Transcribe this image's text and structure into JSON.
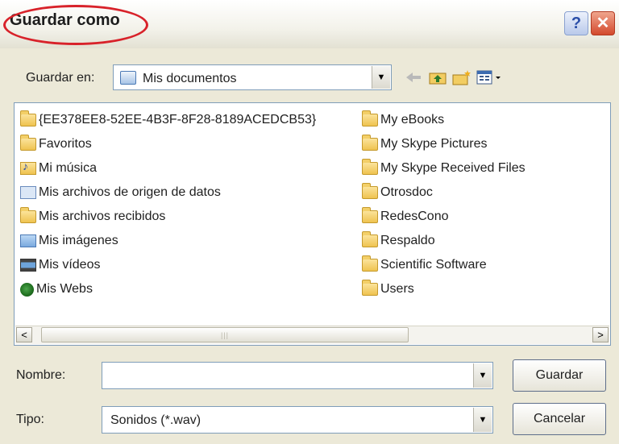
{
  "window": {
    "title": "Guardar como"
  },
  "toolbar": {
    "save_in_label": "Guardar en:",
    "location": "Mis documentos"
  },
  "files": {
    "left_column": [
      {
        "name": "{EE378EE8-52EE-4B3F-8F28-8189ACEDCB53}",
        "icon": "folder-icon"
      },
      {
        "name": "Favoritos",
        "icon": "folder-icon"
      },
      {
        "name": "Mi música",
        "icon": "music-folder-icon"
      },
      {
        "name": "Mis archivos de origen de datos",
        "icon": "data-sources-icon"
      },
      {
        "name": "Mis archivos recibidos",
        "icon": "folder-icon"
      },
      {
        "name": "Mis imágenes",
        "icon": "pictures-folder-icon"
      },
      {
        "name": "Mis vídeos",
        "icon": "videos-folder-icon"
      },
      {
        "name": "Mis Webs",
        "icon": "webs-globe-icon"
      }
    ],
    "right_column": [
      {
        "name": "My eBooks",
        "icon": "folder-icon"
      },
      {
        "name": "My Skype Pictures",
        "icon": "folder-icon"
      },
      {
        "name": "My Skype Received Files",
        "icon": "folder-icon"
      },
      {
        "name": "Otrosdoc",
        "icon": "folder-icon"
      },
      {
        "name": "RedesCono",
        "icon": "folder-icon"
      },
      {
        "name": "Respaldo",
        "icon": "folder-icon"
      },
      {
        "name": "Scientific Software",
        "icon": "folder-icon"
      },
      {
        "name": "Users",
        "icon": "folder-icon"
      }
    ]
  },
  "form": {
    "name_label": "Nombre:",
    "name_value": "",
    "type_label": "Tipo:",
    "type_value": "Sonidos (*.wav)"
  },
  "buttons": {
    "save": "Guardar",
    "cancel": "Cancelar"
  }
}
